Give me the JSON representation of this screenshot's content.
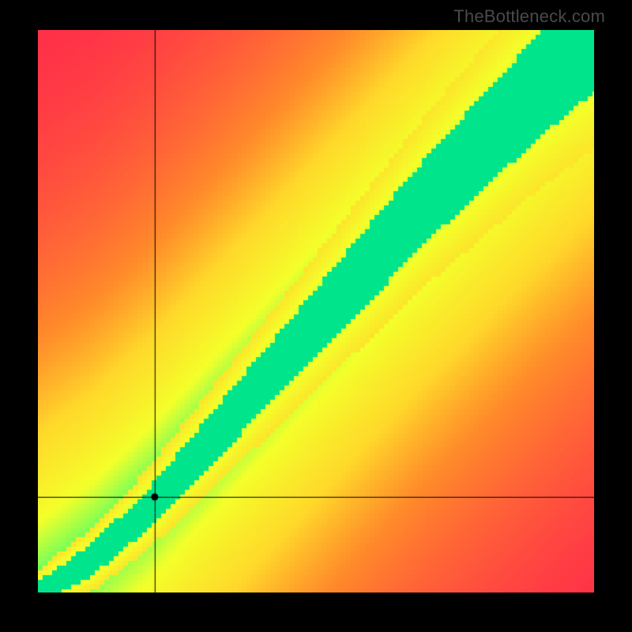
{
  "watermark": "TheBottleneck.com",
  "chart_data": {
    "type": "heatmap",
    "title": "",
    "xlabel": "",
    "ylabel": "",
    "xlim": [
      0,
      100
    ],
    "ylim": [
      0,
      100
    ],
    "crosshair": {
      "x": 21,
      "y": 17
    },
    "ideal_band": {
      "description": "green optimal-match band running diagonally; slightly curved near origin then linear",
      "points_center": [
        {
          "x": 0,
          "y": 0
        },
        {
          "x": 10,
          "y": 6
        },
        {
          "x": 20,
          "y": 15
        },
        {
          "x": 30,
          "y": 26
        },
        {
          "x": 40,
          "y": 37
        },
        {
          "x": 50,
          "y": 48
        },
        {
          "x": 60,
          "y": 59
        },
        {
          "x": 70,
          "y": 70
        },
        {
          "x": 80,
          "y": 80
        },
        {
          "x": 90,
          "y": 90
        },
        {
          "x": 100,
          "y": 99
        }
      ],
      "band_halfwidth_start": 2,
      "band_halfwidth_end": 10
    },
    "color_scale": [
      {
        "stop": 0.0,
        "color": "#ff2b4a"
      },
      {
        "stop": 0.35,
        "color": "#ff8a2a"
      },
      {
        "stop": 0.55,
        "color": "#ffd92a"
      },
      {
        "stop": 0.78,
        "color": "#f4ff2a"
      },
      {
        "stop": 0.92,
        "color": "#7dff55"
      },
      {
        "stop": 1.0,
        "color": "#00e58b"
      }
    ],
    "grid": false,
    "legend": false
  }
}
